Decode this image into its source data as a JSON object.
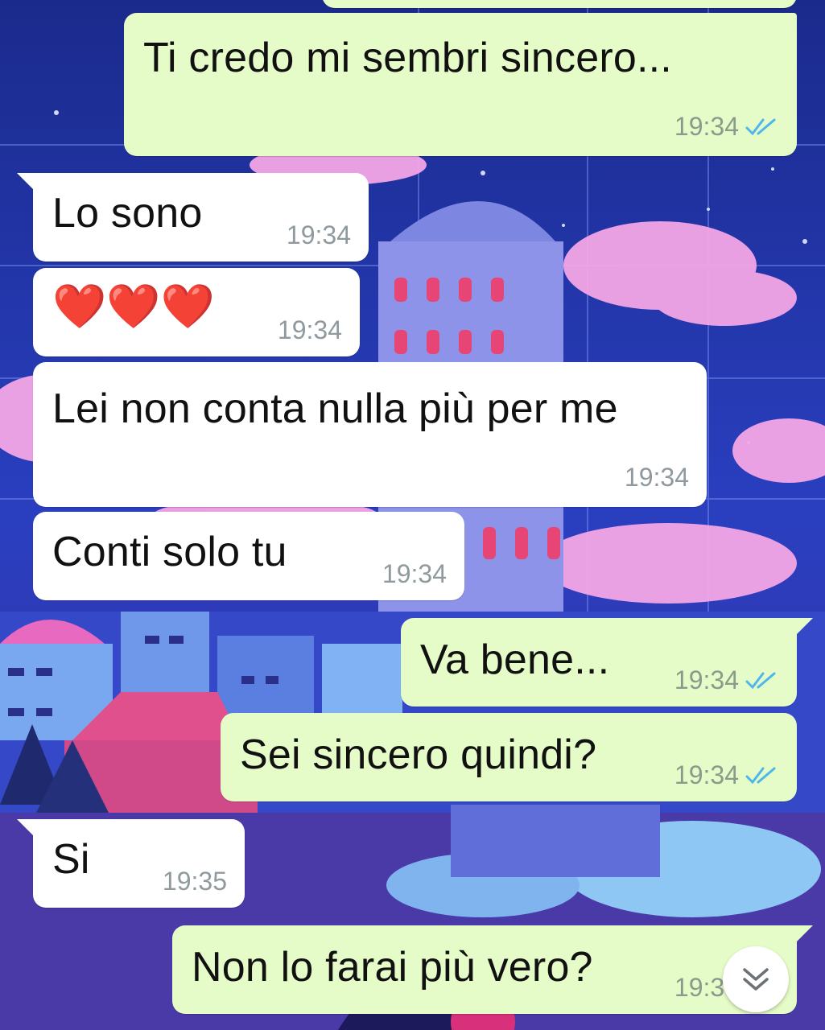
{
  "messages": [
    {
      "direction": "out",
      "text": "Ti credo mi sembri sincero...",
      "time": "19:34",
      "status": "read"
    },
    {
      "direction": "in",
      "text": "Lo sono",
      "time": "19:34"
    },
    {
      "direction": "in",
      "text": "❤️❤️❤️",
      "time": "19:34"
    },
    {
      "direction": "in",
      "text": "Lei non conta nulla più per me",
      "time": "19:34"
    },
    {
      "direction": "in",
      "text": "Conti solo tu",
      "time": "19:34"
    },
    {
      "direction": "out",
      "text": "Va bene...",
      "time": "19:34",
      "status": "read"
    },
    {
      "direction": "out",
      "text": "Sei sincero quindi?",
      "time": "19:34",
      "status": "read"
    },
    {
      "direction": "in",
      "text": "Si",
      "time": "19:35"
    },
    {
      "direction": "out",
      "text": "Non lo farai più vero?",
      "time": "19:35",
      "status": "read"
    }
  ],
  "colors": {
    "incoming_bubble": "#ffffff",
    "outgoing_bubble": "#e6fcc8",
    "read_ticks": "#4fb6ec",
    "timestamp": "#8f9a9e"
  },
  "icons": {
    "read_receipt": "double-check-icon",
    "scroll_down": "chevron-double-down-icon"
  }
}
